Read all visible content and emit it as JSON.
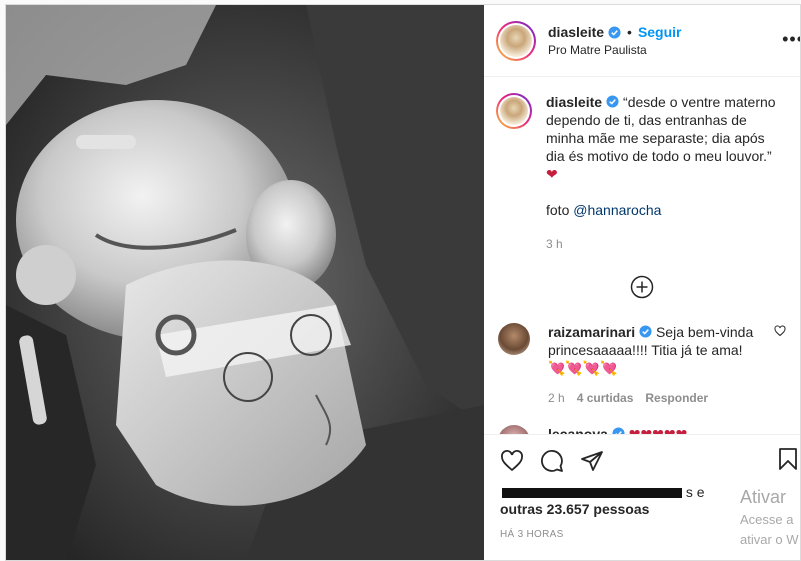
{
  "post": {
    "author": {
      "username": "diasleite",
      "verified": true,
      "follow_label": "Seguir",
      "location": "Pro Matre Paulista"
    },
    "caption": {
      "username": "diasleite",
      "text": "“desde o ventre materno dependo de ti, das entranhas de minha mãe me separaste; dia após dia és motivo de todo o meu louvor.”",
      "emoji": "❤",
      "credit_prefix": "foto ",
      "credit_mention": "@hannarocha",
      "time": "3 h"
    },
    "comments": [
      {
        "username": "raizamarinari",
        "verified": true,
        "text": "Seja bem-vinda princesaaaaa!!!! Titia já te ama! ",
        "emoji": "💘💘💘💘",
        "time": "2 h",
        "likes": "4 curtidas",
        "reply": "Responder"
      },
      {
        "username": "lecanova",
        "verified": true,
        "emoji": "❤❤❤❤❤"
      }
    ],
    "likes": {
      "line1_suffix": "s e",
      "line2": "outras 23.657 pessoas"
    },
    "posted": "HÁ 3 HORAS"
  },
  "watermark": {
    "title": "Ativar",
    "line1": "Acesse a",
    "line2": "ativar o W"
  },
  "colors": {
    "link_blue": "#0095f6",
    "mention_blue": "#00376b",
    "heart_red": "#c41f3e",
    "muted": "#8e8e8e",
    "verified_blue": "#3897f0"
  },
  "icons": [
    "verified-badge-icon",
    "more-options-icon",
    "load-more-icon",
    "like-heart-icon",
    "comment-icon",
    "share-icon",
    "bookmark-icon",
    "comment-like-icon"
  ]
}
